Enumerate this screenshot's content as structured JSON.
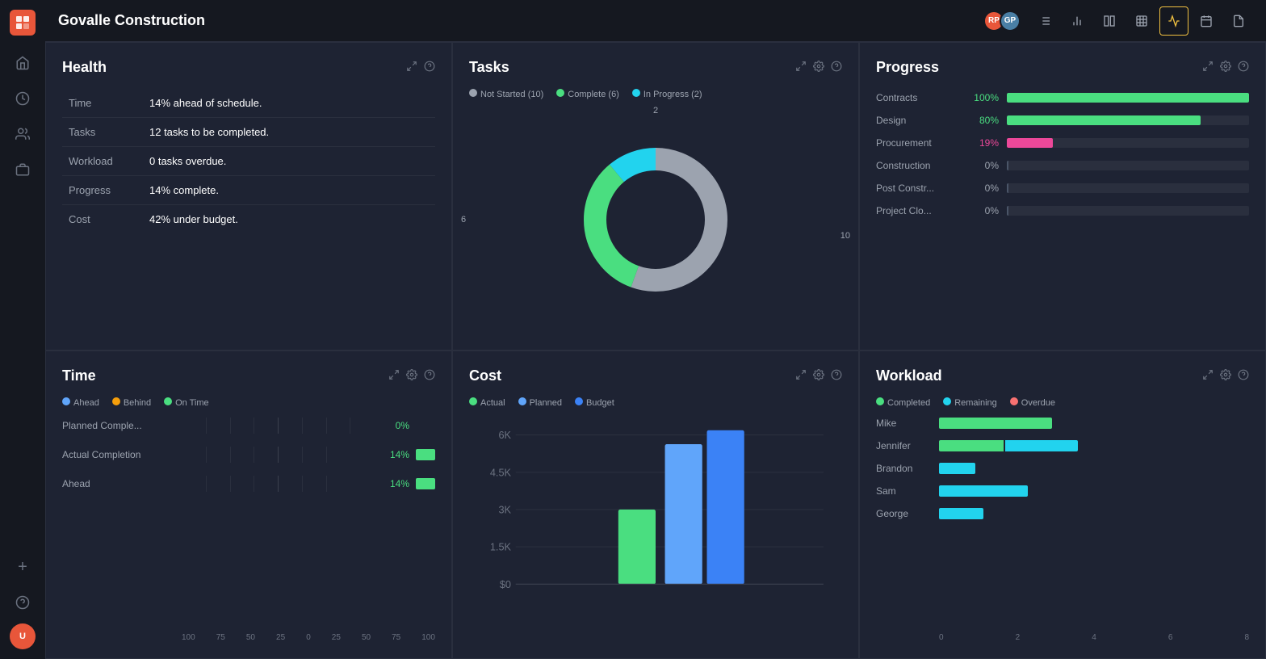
{
  "sidebar": {
    "logo": "PM",
    "icons": [
      "home",
      "clock",
      "users",
      "briefcase"
    ],
    "add_label": "+",
    "help_label": "?",
    "bottom_avatar": "U"
  },
  "topbar": {
    "title": "Govalle Construction",
    "avatars": [
      {
        "initials": "RP",
        "color": "#e8563a"
      },
      {
        "initials": "GP",
        "color": "#4a7fa5"
      }
    ],
    "toolbar_buttons": [
      "list",
      "bar-chart",
      "columns",
      "table",
      "activity",
      "calendar",
      "file"
    ]
  },
  "health": {
    "title": "Health",
    "help": "?",
    "rows": [
      {
        "label": "Time",
        "value": "14% ahead of schedule."
      },
      {
        "label": "Tasks",
        "value": "12 tasks to be completed."
      },
      {
        "label": "Workload",
        "value": "0 tasks overdue."
      },
      {
        "label": "Progress",
        "value": "14% complete."
      },
      {
        "label": "Cost",
        "value": "42% under budget."
      }
    ]
  },
  "tasks": {
    "title": "Tasks",
    "legend": [
      {
        "label": "Not Started",
        "count": 10,
        "color": "#9ca3af"
      },
      {
        "label": "Complete",
        "count": 6,
        "color": "#4ade80"
      },
      {
        "label": "In Progress",
        "count": 2,
        "color": "#22d3ee"
      }
    ],
    "donut": {
      "not_started": 10,
      "complete": 6,
      "in_progress": 2,
      "label_left": "6",
      "label_top": "2",
      "label_right": "10"
    }
  },
  "progress": {
    "title": "Progress",
    "rows": [
      {
        "label": "Contracts",
        "pct": 100,
        "pct_label": "100%",
        "color": "green",
        "bar_width": "100"
      },
      {
        "label": "Design",
        "pct": 80,
        "pct_label": "80%",
        "color": "green",
        "bar_width": "80"
      },
      {
        "label": "Procurement",
        "pct": 19,
        "pct_label": "19%",
        "color": "pink",
        "bar_width": "19"
      },
      {
        "label": "Construction",
        "pct": 0,
        "pct_label": "0%",
        "color": "gray",
        "bar_width": "0"
      },
      {
        "label": "Post Constr...",
        "pct": 0,
        "pct_label": "0%",
        "color": "gray",
        "bar_width": "0"
      },
      {
        "label": "Project Clo...",
        "pct": 0,
        "pct_label": "0%",
        "color": "gray",
        "bar_width": "0"
      }
    ]
  },
  "time": {
    "title": "Time",
    "legend": [
      {
        "label": "Ahead",
        "color": "#60a5fa"
      },
      {
        "label": "Behind",
        "color": "#f59e0b"
      },
      {
        "label": "On Time",
        "color": "#4ade80"
      }
    ],
    "rows": [
      {
        "label": "Planned Comple...",
        "pct_label": "0%",
        "pct": 0,
        "show_bar": false
      },
      {
        "label": "Actual Completion",
        "pct_label": "14%",
        "pct": 14,
        "show_bar": true
      },
      {
        "label": "Ahead",
        "pct_label": "14%",
        "pct": 14,
        "show_bar": true
      }
    ],
    "axis": [
      "100",
      "75",
      "50",
      "25",
      "0",
      "25",
      "50",
      "75",
      "100"
    ]
  },
  "cost": {
    "title": "Cost",
    "legend": [
      {
        "label": "Actual",
        "color": "#4ade80"
      },
      {
        "label": "Planned",
        "color": "#60a5fa"
      },
      {
        "label": "Budget",
        "color": "#3b82f6"
      }
    ],
    "y_labels": [
      "6K",
      "4.5K",
      "3K",
      "1.5K",
      "$0"
    ],
    "bars": {
      "actual_height": 120,
      "planned_height": 190,
      "budget_height": 220
    }
  },
  "workload": {
    "title": "Workload",
    "legend": [
      {
        "label": "Completed",
        "color": "#4ade80"
      },
      {
        "label": "Remaining",
        "color": "#22d3ee"
      },
      {
        "label": "Overdue",
        "color": "#f87171"
      }
    ],
    "rows": [
      {
        "name": "Mike",
        "completed": 120,
        "remaining": 0,
        "overdue": 0
      },
      {
        "name": "Jennifer",
        "completed": 80,
        "remaining": 90,
        "overdue": 0
      },
      {
        "name": "Brandon",
        "completed": 0,
        "remaining": 50,
        "overdue": 0
      },
      {
        "name": "Sam",
        "completed": 0,
        "remaining": 110,
        "overdue": 0
      },
      {
        "name": "George",
        "completed": 0,
        "remaining": 55,
        "overdue": 0
      }
    ],
    "axis": [
      "0",
      "2",
      "4",
      "6",
      "8"
    ]
  }
}
